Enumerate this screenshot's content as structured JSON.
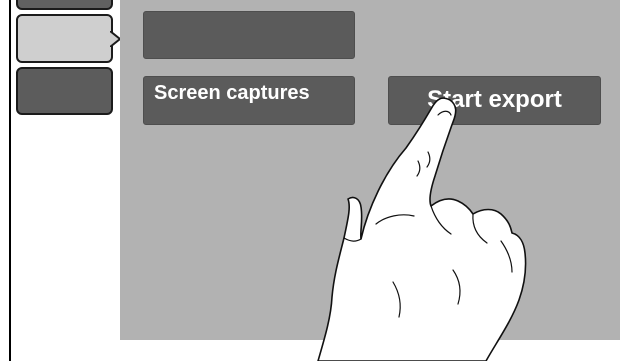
{
  "sidebar": {
    "tabs": [
      {
        "state": "partial"
      },
      {
        "state": "active"
      },
      {
        "state": "inactive"
      }
    ]
  },
  "main": {
    "buttons": {
      "blank_label": "",
      "screen_captures_label": "Screen captures",
      "start_export_label": "Start export"
    }
  },
  "colors": {
    "panel": "#b2b2b2",
    "button": "#5b5b5b",
    "active_tab": "#cfcfcf",
    "inactive_tab": "#5c5c5c"
  },
  "icons": {
    "tab_pointer": "chevron-right-icon",
    "hand": "pointing-hand-icon"
  }
}
